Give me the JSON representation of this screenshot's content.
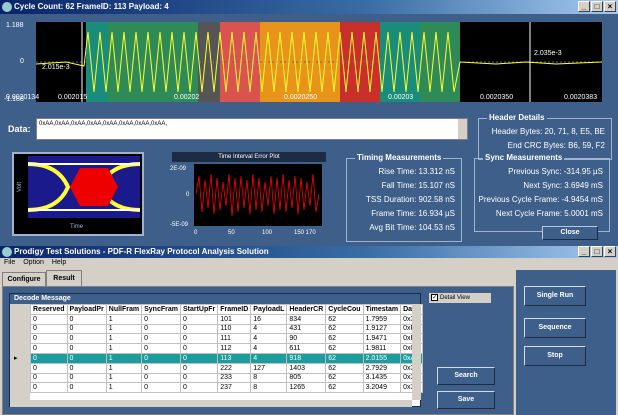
{
  "top": {
    "title": "Cycle Count: 62 FrameID: 113 Payload: 4"
  },
  "scope": {
    "y_top": "1.188",
    "y_mid": "0",
    "y_bottom": "-1.188",
    "x_ticks": [
      "0.0020134",
      "0.002015",
      "0.00202",
      "0.0020250",
      "0.00203",
      "0.0020350",
      "0.0020383"
    ],
    "cursor_left": "2.015e-3",
    "cursor_right": "2.035e-3"
  },
  "data_field": {
    "label": "Data:",
    "value": "0xAA,0xAA,0xAA,0xAA,0xAA,0xAA,0xAA,0xAA,"
  },
  "header_details": {
    "title": "Header Details",
    "header_bytes": "Header Bytes: 20, 71, 8, E5, BE",
    "end_crc": "End CRC Bytes: B6, 59, F2"
  },
  "eye": {
    "ylabel": "Volt",
    "xlabel": "Time"
  },
  "tie": {
    "title": "Time Interval Error Plot",
    "y_top": "2E-09",
    "y_mid": "0",
    "y_bot": "-5E-09",
    "x_ticks": [
      "0",
      "50",
      "100",
      "150 170"
    ]
  },
  "timing": {
    "title": "Timing Measurements",
    "rows": [
      "Rise Time: 13.312 nS",
      "Fall Time: 15.107 nS",
      "TSS Duration: 902.58 nS",
      "Frame Time: 16.934 µS",
      "Avg Bit Time: 104.53 nS"
    ]
  },
  "sync": {
    "title": "Sync Measurements",
    "rows": [
      "Previous Sync: -314.95 µS",
      "Next Sync: 3.6949 mS",
      "Previous Cycle Frame: -4.9454 mS",
      "Next Cycle Frame: 5.0001 mS"
    ],
    "close": "Close"
  },
  "app": {
    "title": "Prodigy Test Solutions - PDF-R FlexRay Protocol Analysis Solution",
    "menu": [
      "File",
      "Option",
      "Help"
    ],
    "tabs": [
      "Configure",
      "Result"
    ]
  },
  "decode": {
    "title": "Decode Message",
    "detail_view": "Detail View",
    "headers": [
      "Reserved",
      "PayloadPr",
      "NullFram",
      "SyncFram",
      "StartUpFr",
      "FrameID",
      "PayloadL",
      "HeaderCR",
      "CycleCou",
      "Timestam",
      "Data"
    ],
    "rows": [
      [
        "0",
        "0",
        "1",
        "0",
        "0",
        "101",
        "16",
        "834",
        "62",
        "1.7959",
        "0x3E"
      ],
      [
        "0",
        "0",
        "1",
        "0",
        "0",
        "110",
        "4",
        "431",
        "62",
        "1.9127",
        "0xF,"
      ],
      [
        "0",
        "0",
        "1",
        "0",
        "0",
        "111",
        "4",
        "90",
        "62",
        "1.9471",
        "0xFF"
      ],
      [
        "0",
        "0",
        "1",
        "0",
        "0",
        "112",
        "4",
        "611",
        "62",
        "1.9811",
        "0x0,"
      ],
      [
        "0",
        "0",
        "1",
        "0",
        "0",
        "113",
        "4",
        "918",
        "62",
        "2.0155",
        "0xAA"
      ],
      [
        "0",
        "0",
        "1",
        "0",
        "0",
        "222",
        "127",
        "1403",
        "62",
        "2.7929",
        "0x3E"
      ],
      [
        "0",
        "0",
        "1",
        "0",
        "0",
        "233",
        "8",
        "805",
        "62",
        "3.1435",
        "0x3E"
      ],
      [
        "0",
        "0",
        "1",
        "0",
        "0",
        "237",
        "8",
        "1265",
        "62",
        "3.2049",
        "0x3E"
      ]
    ],
    "selected": 4
  },
  "buttons": {
    "search": "Search",
    "save": "Save",
    "single_run": "Single Run",
    "sequence": "Sequence",
    "stop": "Stop"
  }
}
